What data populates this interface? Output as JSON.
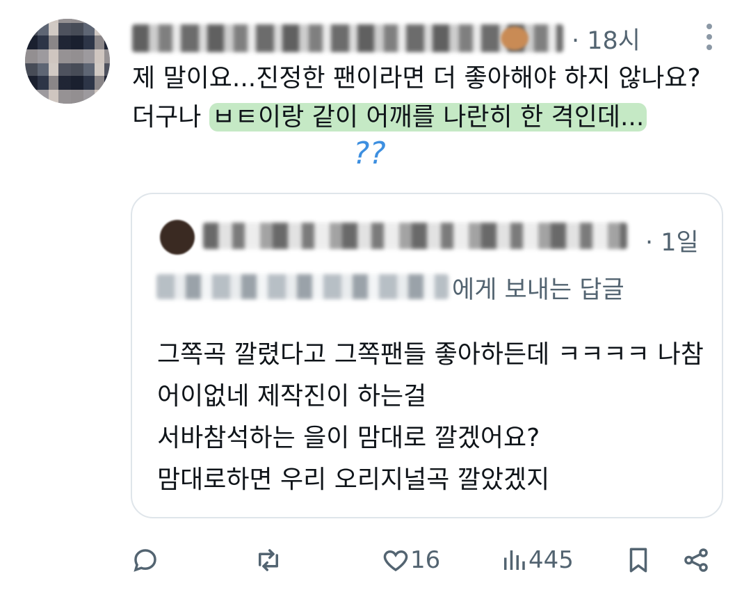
{
  "tweet": {
    "author_name": "",
    "time": "· 18시",
    "text_before": "제 말이요...진정한 팬이라면 더 좋아해야 하지 않나요? 더구나 ",
    "text_highlight": "ㅂㅌ이랑 같이 어깨를 나란히 한 격인데...",
    "annotation": "??"
  },
  "quoted_tweet": {
    "time": "· 1일",
    "reply_to_suffix": "에게 보내는 답글",
    "body": "그쪽곡 깔렸다고 그쪽팬들 좋아하든데 ㅋㅋㅋㅋ 나참 어이없네 제작진이 하는걸\n서바참석하는 을이 맘대로 깔겠어요?\n맘대로하면 우리 오리지널곡 깔았겠지"
  },
  "actions": {
    "reply_icon": "reply-icon",
    "retweet_icon": "retweet-icon",
    "like_icon": "heart-icon",
    "like_count": "16",
    "views_icon": "views-icon",
    "views_count": "445",
    "bookmark_icon": "bookmark-icon",
    "share_icon": "share-icon"
  },
  "colors": {
    "secondary_text": "#536471",
    "highlight": "#96d796",
    "border": "#dfe5ea"
  }
}
